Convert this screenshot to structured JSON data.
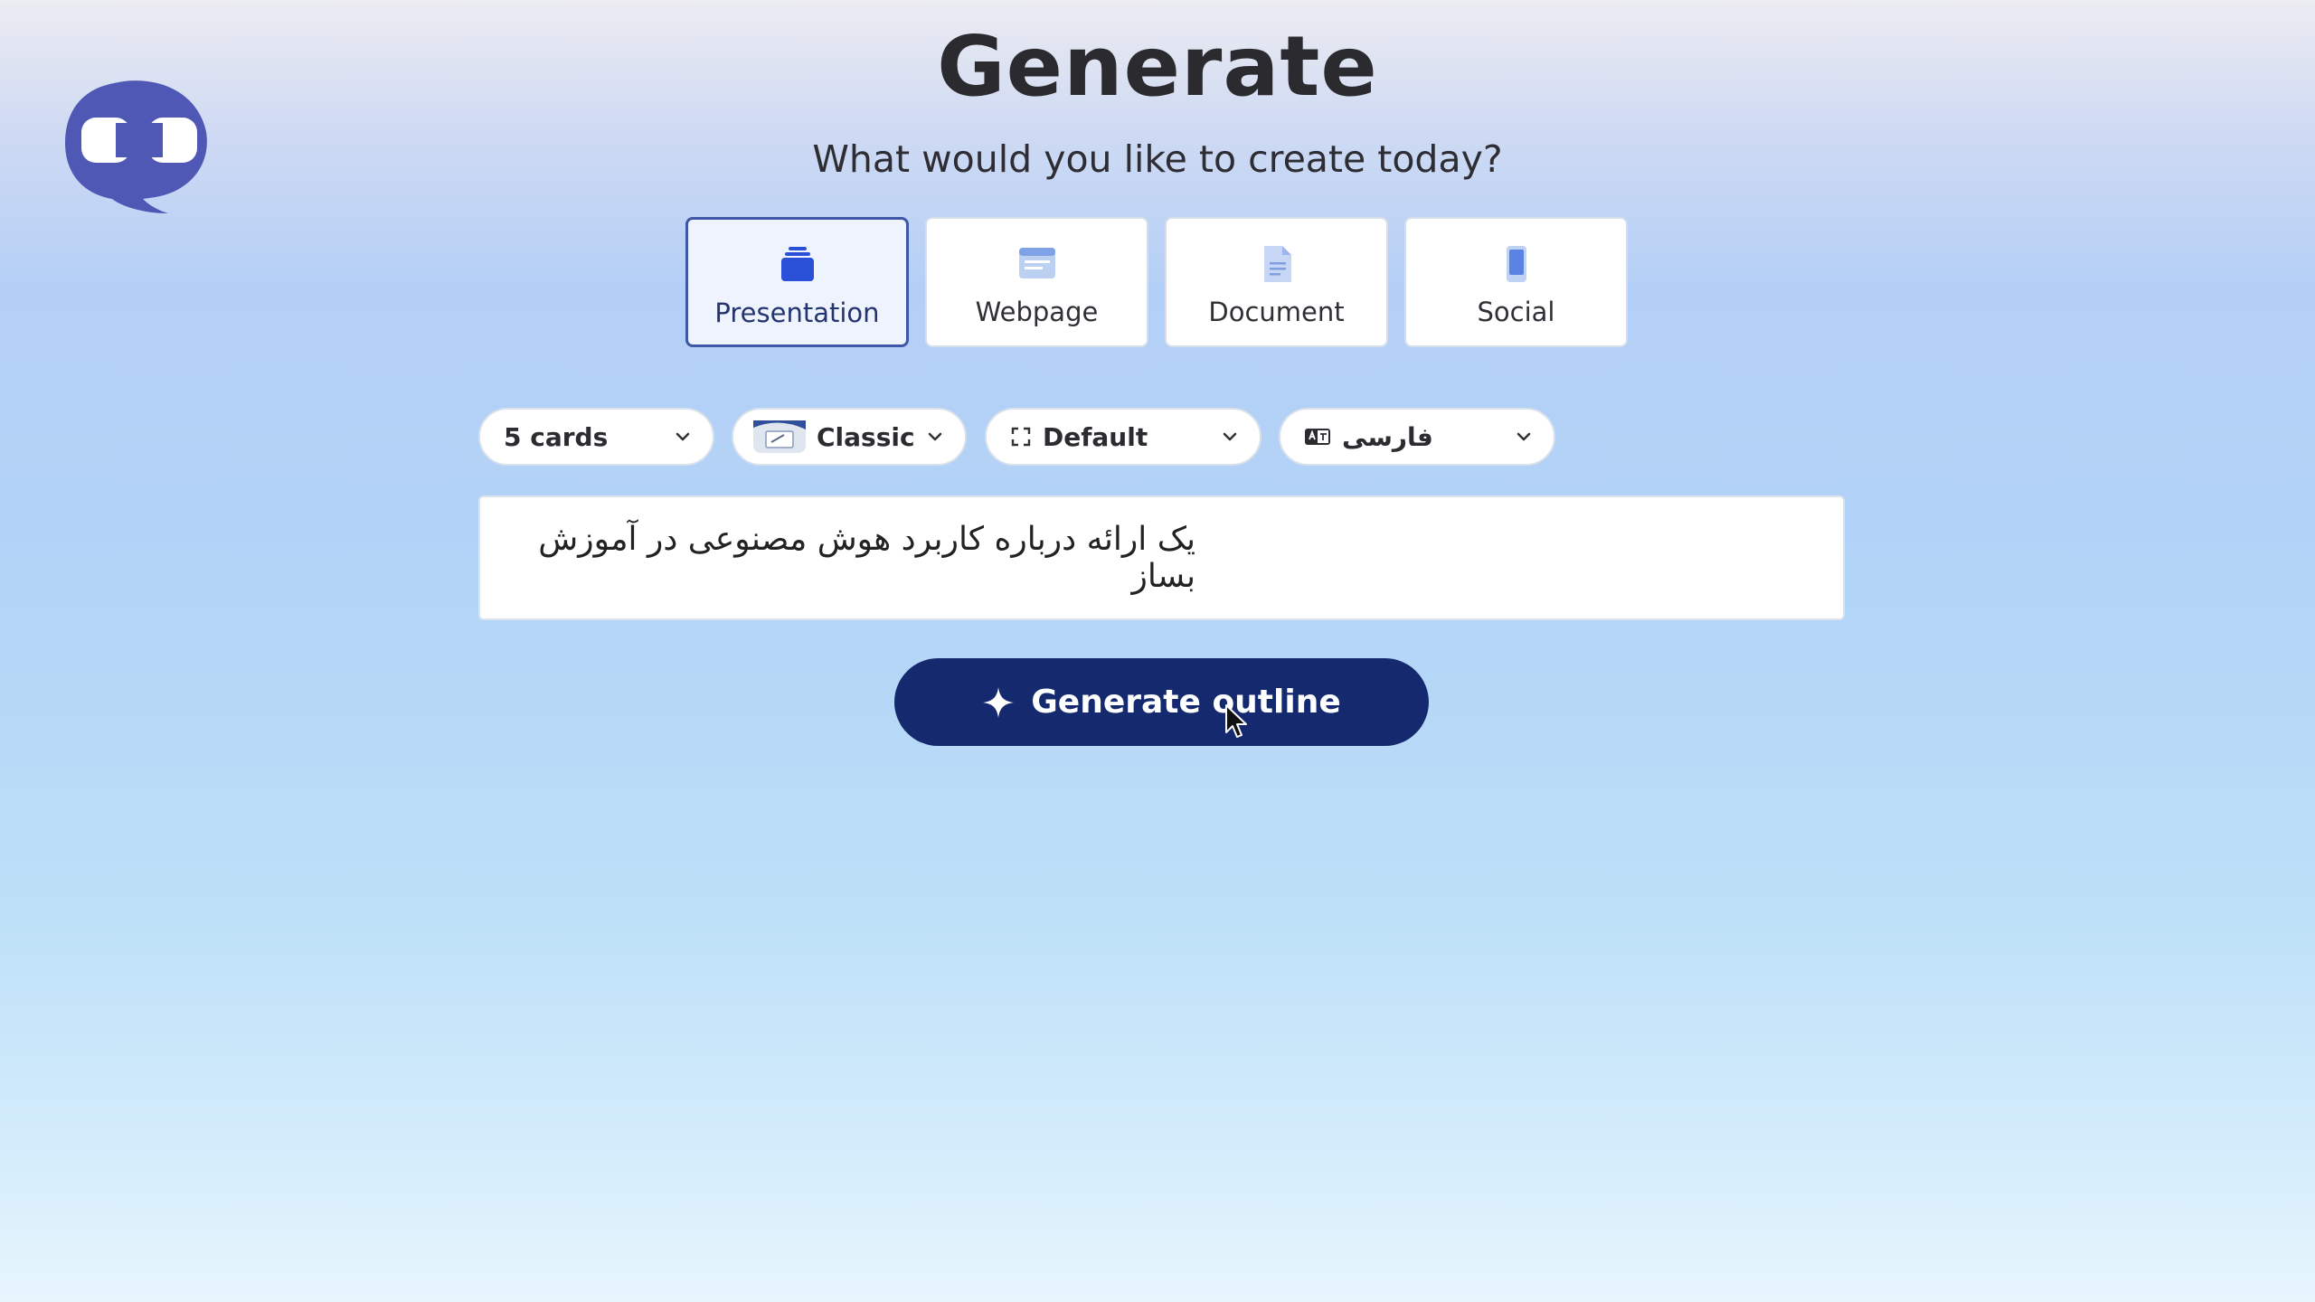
{
  "header": {
    "title": "Generate",
    "subtitle": "What would you like to create today?"
  },
  "types": [
    {
      "label": "Presentation",
      "icon": "presentation-stack-icon",
      "selected": true
    },
    {
      "label": "Webpage",
      "icon": "webpage-icon",
      "selected": false
    },
    {
      "label": "Document",
      "icon": "document-icon",
      "selected": false
    },
    {
      "label": "Social",
      "icon": "phone-icon",
      "selected": false
    }
  ],
  "options": {
    "cards": "5 cards",
    "theme": "Classic",
    "size": "Default",
    "language": "فارسی"
  },
  "prompt": {
    "value": "یک ارائه درباره کاربرد هوش مصنوعی در آموزش بساز"
  },
  "action": {
    "generate_label": "Generate outline",
    "icon": "sparkle-icon"
  },
  "colors": {
    "accent": "#152a6e",
    "selected_border": "#3e57a6",
    "logo": "#4f58b4",
    "icon_blue": "#2b50d8"
  }
}
